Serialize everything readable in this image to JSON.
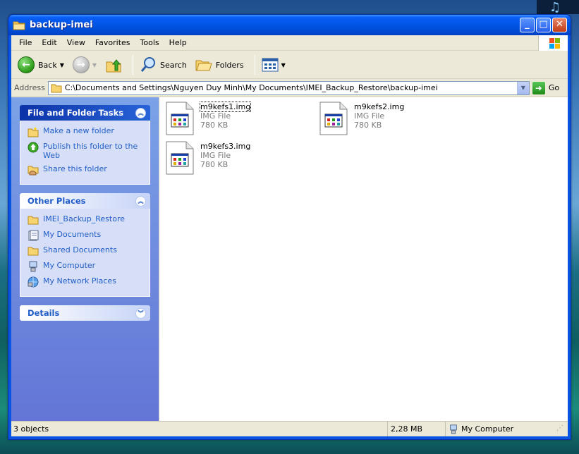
{
  "window": {
    "title": "backup-imei"
  },
  "menu": [
    "File",
    "Edit",
    "View",
    "Favorites",
    "Tools",
    "Help"
  ],
  "toolbar": {
    "back": "Back",
    "search": "Search",
    "folders": "Folders"
  },
  "address": {
    "label": "Address",
    "path": "C:\\Documents and Settings\\Nguyen Duy Minh\\My Documents\\IMEI_Backup_Restore\\backup-imei",
    "go": "Go"
  },
  "tasks": {
    "title": "File and Folder Tasks",
    "items": [
      {
        "label": "Make a new folder",
        "icon": "new-folder-icon"
      },
      {
        "label": "Publish this folder to the Web",
        "icon": "publish-web-icon"
      },
      {
        "label": "Share this folder",
        "icon": "share-folder-icon"
      }
    ]
  },
  "places": {
    "title": "Other Places",
    "items": [
      {
        "label": "IMEI_Backup_Restore",
        "icon": "folder-icon"
      },
      {
        "label": "My Documents",
        "icon": "my-documents-icon"
      },
      {
        "label": "Shared Documents",
        "icon": "folder-icon"
      },
      {
        "label": "My Computer",
        "icon": "my-computer-icon"
      },
      {
        "label": "My Network Places",
        "icon": "network-places-icon"
      }
    ]
  },
  "details": {
    "title": "Details"
  },
  "files": [
    {
      "name": "m9kefs1.img",
      "type": "IMG File",
      "size": "780 KB"
    },
    {
      "name": "m9kefs2.img",
      "type": "IMG File",
      "size": "780 KB"
    },
    {
      "name": "m9kefs3.img",
      "type": "IMG File",
      "size": "780 KB"
    }
  ],
  "status": {
    "objects": "3 objects",
    "size": "2,28 MB",
    "zone": "My Computer"
  },
  "colors": {
    "titlebar": "#0055e5",
    "taskpane": "#6375d6",
    "link": "#215dc6"
  }
}
